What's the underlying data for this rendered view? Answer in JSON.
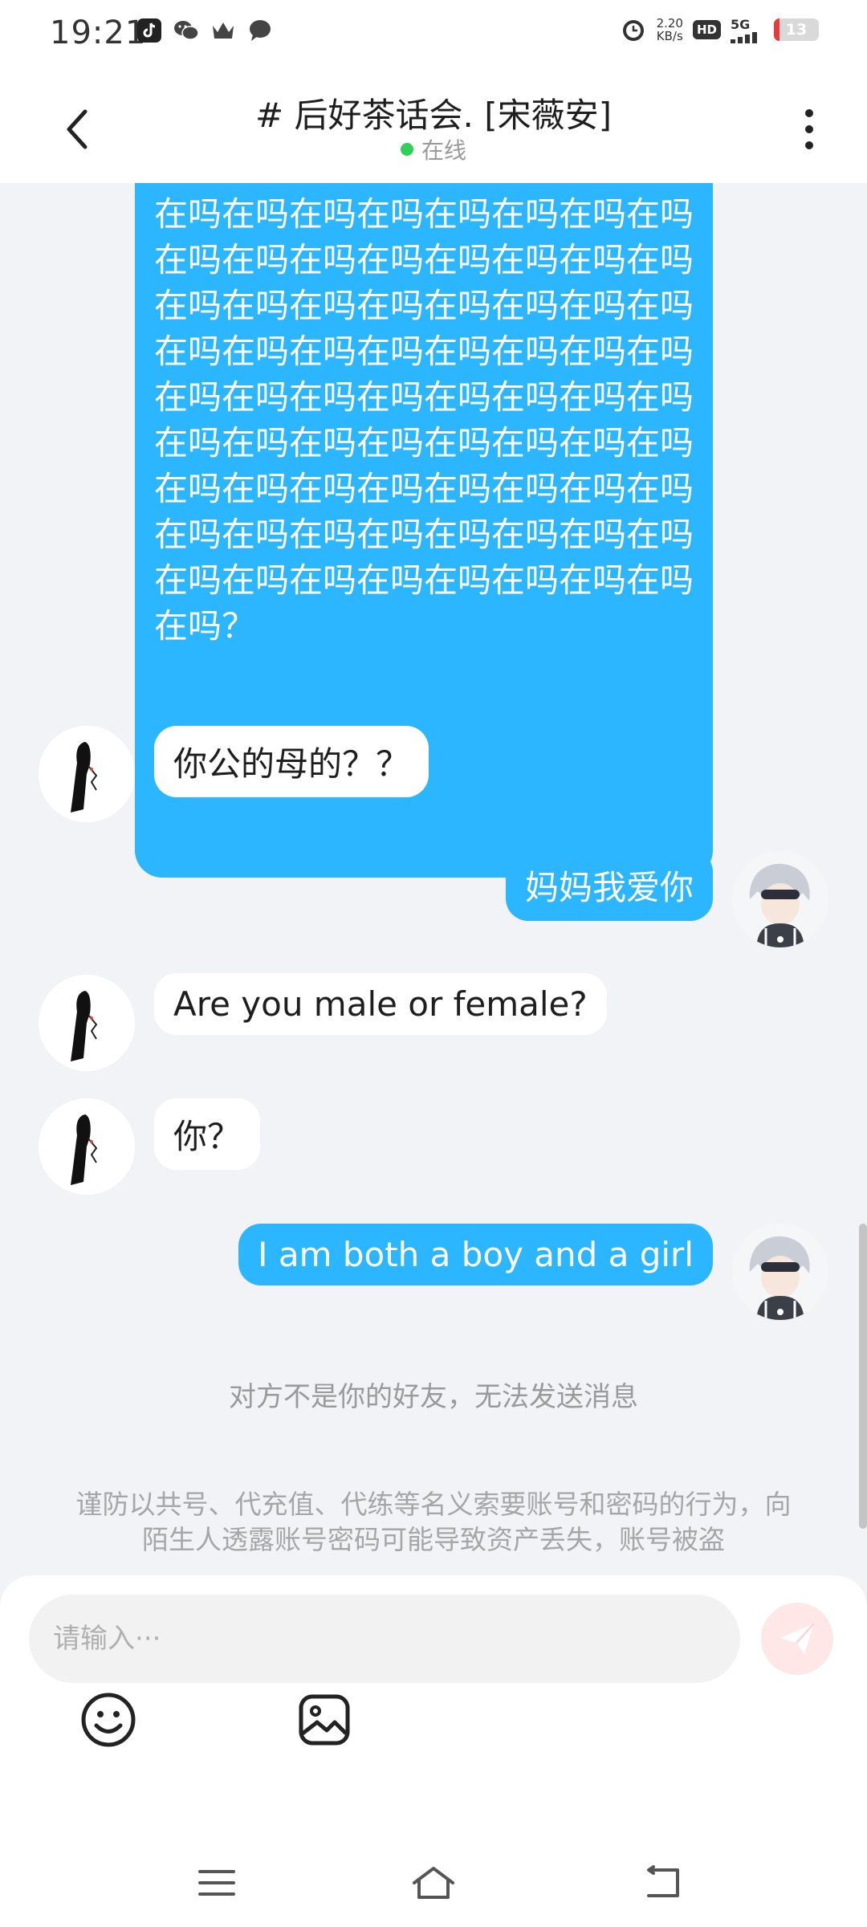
{
  "status_bar": {
    "time": "19:21",
    "speed_value": "2.20",
    "speed_unit": "KB/s",
    "hd_label": "HD",
    "network": "5G",
    "battery": "13",
    "battery_level": 0.13,
    "app_icons": [
      "tiktok-icon",
      "wechat-icon",
      "crown-icon",
      "chat-bubble-icon"
    ]
  },
  "header": {
    "title": "# 后好茶话会. [宋薇安]",
    "status": "在线",
    "status_color": "#2fcf5a"
  },
  "messages": [
    {
      "direction": "out",
      "text": "在吗在吗在吗在吗在吗在吗在吗在吗在吗在吗在吗在吗在吗在吗在吗在吗在吗在吗在吗在吗在吗在吗在吗在吗在吗在吗在吗在吗在吗在吗在吗在吗在吗在吗在吗在吗在吗在吗在吗在吗在吗在吗在吗在吗在吗在吗在吗在吗在吗在吗在吗在吗在吗在吗在吗在吗在吗在吗在吗在吗在吗在吗在吗在吗在吗在吗在吗在吗在吗在吗在吗在吗在吗？"
    },
    {
      "direction": "in",
      "text": "你公的母的？？"
    },
    {
      "direction": "out",
      "text": "妈妈我爱你"
    },
    {
      "direction": "in",
      "text": "Are you male or female?"
    },
    {
      "direction": "in",
      "text": "你？"
    },
    {
      "direction": "out",
      "text": "I am both a boy and a girl"
    }
  ],
  "notices": {
    "not_friend": "对方不是你的好友，无法发送消息",
    "warning": "谨防以共号、代充值、代练等名义索要账号和密码的行为，向陌生人透露账号密码可能导致资产丢失，账号被盗"
  },
  "input": {
    "placeholder": "请输入···"
  },
  "colors": {
    "outgoing_bubble": "#2cb6ff",
    "incoming_bubble": "#ffffff",
    "background": "#f2f3f6"
  }
}
